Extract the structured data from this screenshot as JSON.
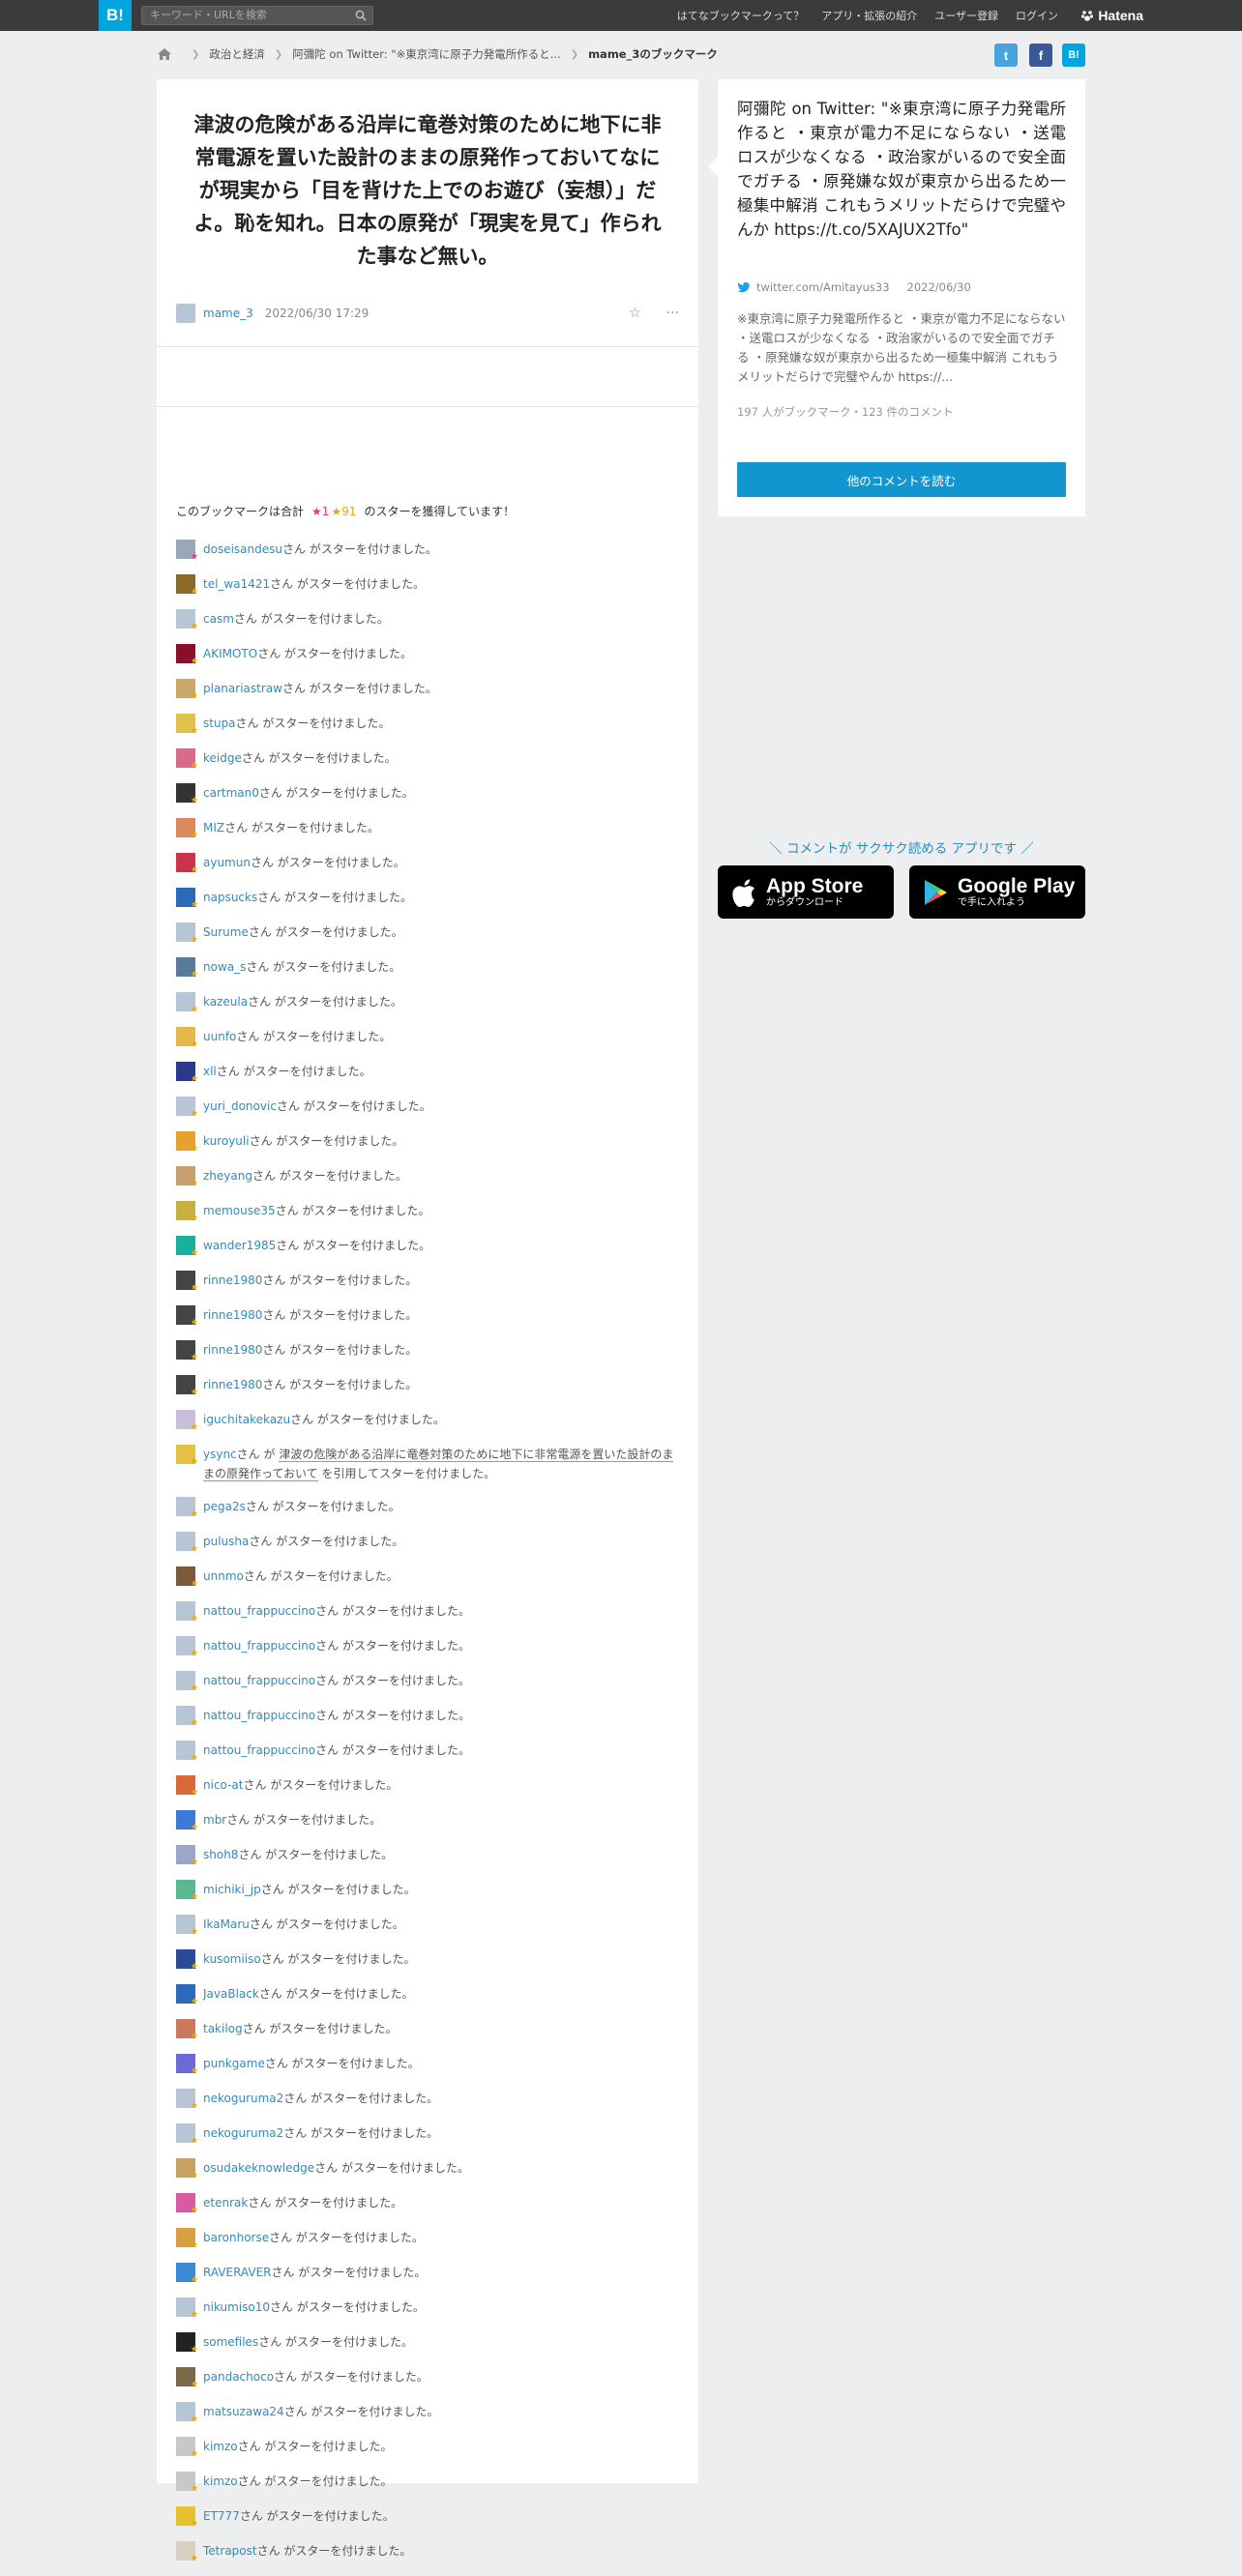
{
  "header": {
    "logo": "B!",
    "search_placeholder": "キーワード・URLを検索",
    "nav": [
      "はてなブックマークって？",
      "アプリ・拡張の紹介",
      "ユーザー登録",
      "ログイン"
    ],
    "brand": "Hatena"
  },
  "breadcrumb": {
    "items": [
      "政治と経済",
      "阿彌陀 on Twitter: \"※東京湾に原子力発電所作ると..."
    ],
    "current": "mame_3のブックマーク"
  },
  "share": {
    "twitter": "t",
    "facebook": "f",
    "hatena": "B!"
  },
  "bookmark": {
    "comment": "津波の危険がある沿岸に竜巻対策のために地下に非常電源を置いた設計のままの原発作っておいてなにが現実から「目を背けた上でのお遊び（妄想）」だよ。恥を知れ。日本の原発が「現実を見て」作られた事など無い。",
    "user": "mame_3",
    "date": "2022/06/30 17:29",
    "star_icon": "☆",
    "more_icon": "···"
  },
  "summary": {
    "prefix": "このブックマークは合計",
    "red": "★1",
    "yellow": "★91",
    "suffix": "のスターを獲得しています！"
  },
  "star_suffix": "さん がスターを付けました。",
  "quote_row": {
    "user": "ysync",
    "pre": "さん が",
    "quote": "津波の危険がある沿岸に竜巻対策のために地下に非常電源を置いた設計のままの原発作っておいて",
    "post": "を引用してスターを付けました。"
  },
  "stars_before_quote": [
    {
      "user": "doseisandesu",
      "color": "#9aa7b8"
    },
    {
      "user": "tel_wa1421",
      "color": "#8a6a2a"
    },
    {
      "user": "casm",
      "color": "#b7c6d6"
    },
    {
      "user": "AKIMOTO",
      "color": "#8a0f2a"
    },
    {
      "user": "planariastraw",
      "color": "#c9a86a"
    },
    {
      "user": "stupa",
      "color": "#e0c14a"
    },
    {
      "user": "keidge",
      "color": "#d86a8a"
    },
    {
      "user": "cartman0",
      "color": "#333333"
    },
    {
      "user": "MIZ",
      "color": "#d88a5a"
    },
    {
      "user": "ayumun",
      "color": "#c9344a"
    },
    {
      "user": "napsucks",
      "color": "#2a6ab8"
    },
    {
      "user": "Surume",
      "color": "#b7c6d6"
    },
    {
      "user": "nowa_s",
      "color": "#5a7a9a"
    },
    {
      "user": "kazeula",
      "color": "#b7c6d6"
    },
    {
      "user": "uunfo",
      "color": "#e6b84a"
    },
    {
      "user": "xll",
      "color": "#2a3a8a"
    },
    {
      "user": "yuri_donovic",
      "color": "#b7c6d6"
    },
    {
      "user": "kuroyuli",
      "color": "#e8a030"
    },
    {
      "user": "zheyang",
      "color": "#c8a070"
    },
    {
      "user": "memouse35",
      "color": "#c8b040"
    },
    {
      "user": "wander1985",
      "color": "#1ab0a0"
    },
    {
      "user": "rinne1980",
      "color": "#444444"
    },
    {
      "user": "rinne1980",
      "color": "#444444"
    },
    {
      "user": "rinne1980",
      "color": "#444444"
    },
    {
      "user": "rinne1980",
      "color": "#444444"
    },
    {
      "user": "iguchitakekazu",
      "color": "#c8c0d8"
    }
  ],
  "stars_after_quote": [
    {
      "user": "pega2s",
      "color": "#b7c6d6"
    },
    {
      "user": "pulusha",
      "color": "#b7c6d6"
    },
    {
      "user": "unnmo",
      "color": "#7a5a3a"
    },
    {
      "user": "nattou_frappuccino",
      "color": "#b7c6d6"
    },
    {
      "user": "nattou_frappuccino",
      "color": "#b7c6d6"
    },
    {
      "user": "nattou_frappuccino",
      "color": "#b7c6d6"
    },
    {
      "user": "nattou_frappuccino",
      "color": "#b7c6d6"
    },
    {
      "user": "nattou_frappuccino",
      "color": "#b7c6d6"
    },
    {
      "user": "nico-at",
      "color": "#d86a3a"
    },
    {
      "user": "mbr",
      "color": "#3a7ad8"
    },
    {
      "user": "shoh8",
      "color": "#9aa7c8"
    },
    {
      "user": "michiki_jp",
      "color": "#5ab890"
    },
    {
      "user": "IkaMaru",
      "color": "#b7c6d6"
    },
    {
      "user": "kusomiiso",
      "color": "#2a4a9a"
    },
    {
      "user": "JavaBlack",
      "color": "#2a6ab8"
    },
    {
      "user": "takilog",
      "color": "#c87a5a"
    },
    {
      "user": "punkgame",
      "color": "#6a6ad8"
    },
    {
      "user": "nekoguruma2",
      "color": "#b7c6d6"
    },
    {
      "user": "nekoguruma2",
      "color": "#b7c6d6"
    },
    {
      "user": "osudakeknowledge",
      "color": "#c8a060"
    },
    {
      "user": "etenrak",
      "color": "#d85aa0"
    },
    {
      "user": "baronhorse",
      "color": "#d8a040"
    },
    {
      "user": "RAVERAVER",
      "color": "#3a8ad8"
    },
    {
      "user": "nikumiso10",
      "color": "#b7c6d6"
    },
    {
      "user": "somefiles",
      "color": "#222222"
    },
    {
      "user": "pandachoco",
      "color": "#7a6a4a"
    },
    {
      "user": "matsuzawa24",
      "color": "#b7c6d6"
    },
    {
      "user": "kimzo",
      "color": "#c8c8c8"
    },
    {
      "user": "kimzo",
      "color": "#c8c8c8"
    },
    {
      "user": "ET777",
      "color": "#e8c030"
    },
    {
      "user": "Tetrapost",
      "color": "#d8d0c0"
    }
  ],
  "entry": {
    "title": "阿彌陀 on Twitter: \"※東京湾に原子力発電所作ると ・東京が電力不足にならない ・送電ロスが少なくなる ・政治家がいるので安全面でガチる ・原発嫌な奴が東京から出るため一極集中解消 これもうメリットだらけで完璧やんか https://t.co/5XAJUX2Tfo\"",
    "source": "twitter.com/Amitayus33",
    "date": "2022/06/30",
    "description": "※東京湾に原子力発電所作ると ・東京が電力不足にならない ・送電ロスが少なくなる ・政治家がいるので安全面でガチる ・原発嫌な奴が東京から出るため一極集中解消 これもうメリットだらけで完璧やんか https://...",
    "counts": "197 人がブックマーク・123 件のコメント",
    "more_button": "他のコメントを読む"
  },
  "promo": {
    "text": "＼ コメントが サクサク読める アプリです ／",
    "appstore_big": "App Store",
    "appstore_small": "からダウンロード",
    "googleplay_big": "Google Play",
    "googleplay_small": "で手に入れよう"
  },
  "colors": {
    "link": "#2c8dc2",
    "accent": "#00a4de",
    "button": "#1296d0",
    "star_yellow": "#e4a814",
    "star_red": "#e8396b"
  }
}
